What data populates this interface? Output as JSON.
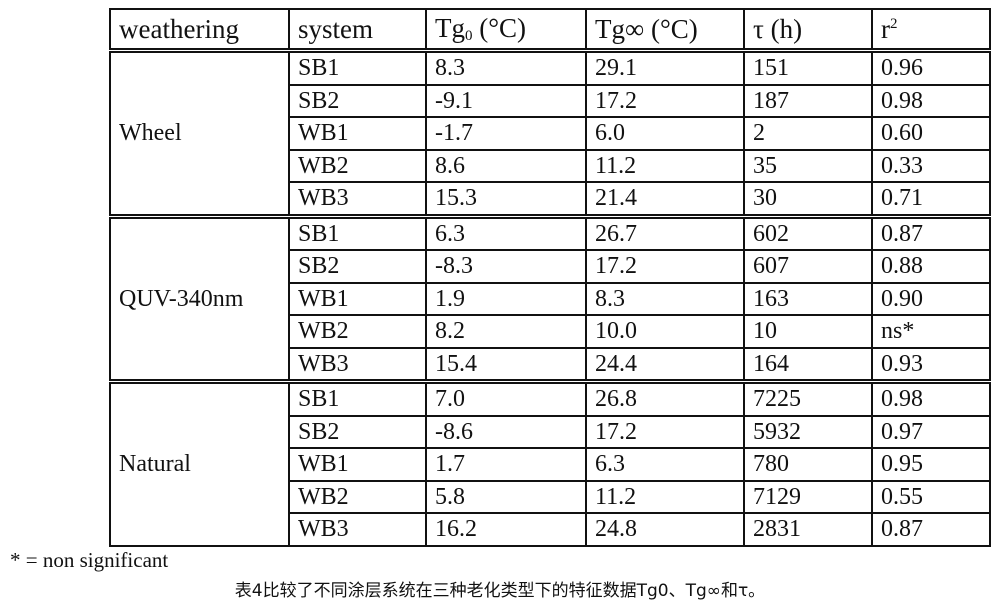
{
  "table": {
    "headers": {
      "weathering": "weathering",
      "system": "system",
      "tg0_base": "Tg",
      "tg0_sub": "0",
      "tg0_unit": " (°C)",
      "tginf": "Tg∞ (°C)",
      "tau": "τ (h)",
      "r2_base": "r",
      "r2_sup": "2"
    },
    "groups": [
      {
        "weathering": "Wheel",
        "rows": [
          {
            "system": "SB1",
            "tg0": "8.3",
            "tginf": "29.1",
            "tau": "151",
            "r2": "0.96"
          },
          {
            "system": "SB2",
            "tg0": "-9.1",
            "tginf": "17.2",
            "tau": "187",
            "r2": "0.98"
          },
          {
            "system": "WB1",
            "tg0": "-1.7",
            "tginf": "6.0",
            "tau": "2",
            "r2": "0.60"
          },
          {
            "system": "WB2",
            "tg0": "8.6",
            "tginf": "11.2",
            "tau": "35",
            "r2": "0.33"
          },
          {
            "system": "WB3",
            "tg0": "15.3",
            "tginf": "21.4",
            "tau": "30",
            "r2": "0.71"
          }
        ]
      },
      {
        "weathering": "QUV-340nm",
        "rows": [
          {
            "system": "SB1",
            "tg0": "6.3",
            "tginf": "26.7",
            "tau": "602",
            "r2": "0.87"
          },
          {
            "system": "SB2",
            "tg0": "-8.3",
            "tginf": "17.2",
            "tau": "607",
            "r2": "0.88"
          },
          {
            "system": "WB1",
            "tg0": "1.9",
            "tginf": "8.3",
            "tau": "163",
            "r2": "0.90"
          },
          {
            "system": "WB2",
            "tg0": "8.2",
            "tginf": "10.0",
            "tau": "10",
            "r2": "ns*"
          },
          {
            "system": "WB3",
            "tg0": "15.4",
            "tginf": "24.4",
            "tau": "164",
            "r2": "0.93"
          }
        ]
      },
      {
        "weathering": "Natural",
        "rows": [
          {
            "system": "SB1",
            "tg0": "7.0",
            "tginf": "26.8",
            "tau": "7225",
            "r2": "0.98"
          },
          {
            "system": "SB2",
            "tg0": "-8.6",
            "tginf": "17.2",
            "tau": "5932",
            "r2": "0.97"
          },
          {
            "system": "WB1",
            "tg0": "1.7",
            "tginf": "6.3",
            "tau": "780",
            "r2": "0.95"
          },
          {
            "system": "WB2",
            "tg0": "5.8",
            "tginf": "11.2",
            "tau": "7129",
            "r2": "0.55"
          },
          {
            "system": "WB3",
            "tg0": "16.2",
            "tginf": "24.8",
            "tau": "2831",
            "r2": "0.87"
          }
        ]
      }
    ]
  },
  "footnote": "* = non significant",
  "caption": "表4比较了不同涂层系统在三种老化类型下的特征数据Tg0、Tg∞和τ。"
}
